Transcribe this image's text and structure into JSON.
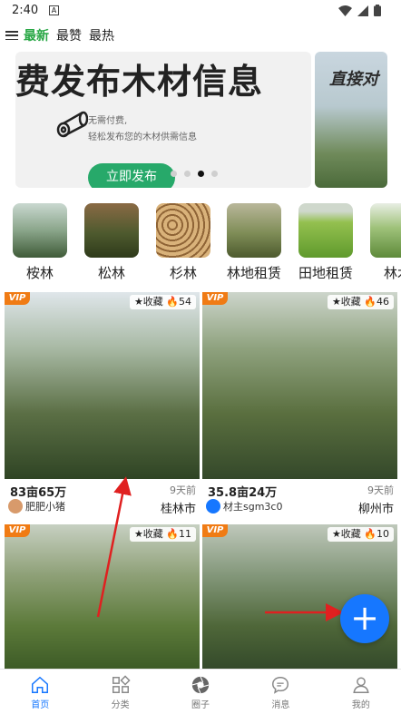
{
  "status_bar": {
    "time": "2:40",
    "notif_label": "A"
  },
  "tabs": [
    {
      "label": "最新",
      "active": true
    },
    {
      "label": "最赞",
      "active": false
    },
    {
      "label": "最热",
      "active": false
    }
  ],
  "banner": {
    "heading": "费发布木材信息",
    "sub_line1": "无需付费,",
    "sub_line2": "轻松发布您的木材供需信息",
    "cta": "立即发布",
    "side_text": "直接对",
    "dot_count": 4,
    "active_dot": 2
  },
  "categories": [
    {
      "label": "桉林",
      "color": "#7d9b7a"
    },
    {
      "label": "松林",
      "color": "#6b5a3e"
    },
    {
      "label": "杉林",
      "color": "#b08a60"
    },
    {
      "label": "林地租赁",
      "color": "#7a8a55"
    },
    {
      "label": "田地租赁",
      "color": "#7fb545"
    },
    {
      "label": "林木",
      "color": "#8fb06a"
    }
  ],
  "cards": [
    {
      "vip": "VIP",
      "stats": "★收藏 🔥54",
      "price": "83亩65万",
      "time": "9天前",
      "user": "肥肥小猪",
      "city": "桂林市",
      "avatar_color": "#d89a6b"
    },
    {
      "vip": "VIP",
      "stats": "★收藏 🔥46",
      "price": "35.8亩24万",
      "time": "9天前",
      "user": "材主sgm3c0",
      "city": "柳州市",
      "avatar_color": "#1677ff"
    },
    {
      "vip": "VIP",
      "stats": "★收藏 🔥11",
      "price": "",
      "time": "",
      "user": "",
      "city": "",
      "avatar_color": "#999999"
    },
    {
      "vip": "VIP",
      "stats": "★收藏 🔥10",
      "price": "",
      "time": "",
      "user": "",
      "city": "",
      "avatar_color": "#999999"
    }
  ],
  "fab": {
    "label": "+"
  },
  "bottom_nav": [
    {
      "label": "首页",
      "icon": "home-icon",
      "active": true
    },
    {
      "label": "分类",
      "icon": "category-icon",
      "active": false
    },
    {
      "label": "圈子",
      "icon": "aperture-icon",
      "active": false
    },
    {
      "label": "消息",
      "icon": "message-icon",
      "active": false
    },
    {
      "label": "我的",
      "icon": "profile-icon",
      "active": false
    }
  ],
  "colors": {
    "accent": "#28a745",
    "primary": "#1677ff",
    "vip": "#f07b14",
    "arrow": "#e02020"
  }
}
